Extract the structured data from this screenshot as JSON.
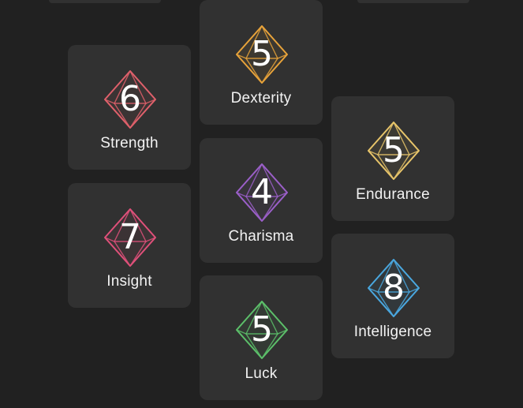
{
  "stats": [
    {
      "id": "dexterity",
      "label": "Dexterity",
      "value": "5",
      "color": "#e8a33a"
    },
    {
      "id": "strength",
      "label": "Strength",
      "value": "6",
      "color": "#e0606b"
    },
    {
      "id": "endurance",
      "label": "Endurance",
      "value": "5",
      "color": "#e8c56a"
    },
    {
      "id": "charisma",
      "label": "Charisma",
      "value": "4",
      "color": "#9b5fc9"
    },
    {
      "id": "insight",
      "label": "Insight",
      "value": "7",
      "color": "#e0507a"
    },
    {
      "id": "intelligence",
      "label": "Intelligence",
      "value": "8",
      "color": "#4aa8e0"
    },
    {
      "id": "luck",
      "label": "Luck",
      "value": "5",
      "color": "#5cc06a"
    }
  ],
  "icons": {
    "die": "d8-octahedron-icon"
  }
}
